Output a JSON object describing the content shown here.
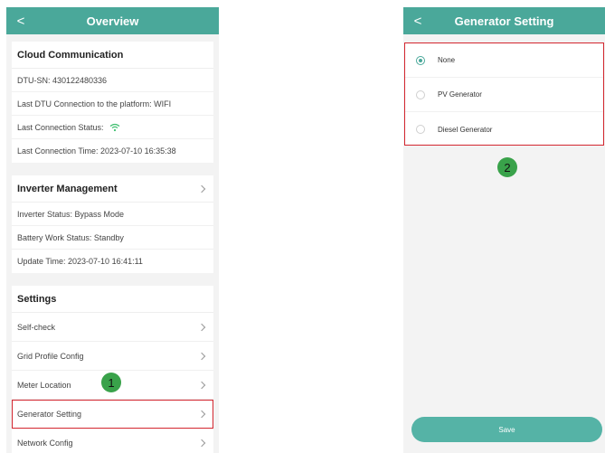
{
  "left": {
    "header": {
      "back_glyph": "<",
      "title": "Overview"
    },
    "cloud": {
      "title": "Cloud Communication",
      "dtu_sn": "DTU-SN: 430122480336",
      "last_dtu_conn": "Last DTU Connection to the platform: WIFI",
      "last_conn_status": "Last Connection Status:",
      "status_icon": "wifi-icon",
      "last_conn_time": "Last Connection Time: 2023-07-10 16:35:38"
    },
    "inverter": {
      "title": "Inverter Management",
      "inverter_status": "Inverter Status: Bypass Mode",
      "battery_status": "Battery Work Status: Standby",
      "update_time": "Update Time: 2023-07-10 16:41:11"
    },
    "settings": {
      "title": "Settings",
      "items": [
        {
          "label": "Self-check"
        },
        {
          "label": "Grid Profile Config"
        },
        {
          "label": "Meter Location"
        },
        {
          "label": "Generator Setting"
        },
        {
          "label": "Network Config"
        }
      ]
    },
    "step_badge": "1"
  },
  "right": {
    "header": {
      "back_glyph": "<",
      "title": "Generator Setting"
    },
    "options": [
      {
        "label": "None",
        "selected": true
      },
      {
        "label": "PV Generator",
        "selected": false
      },
      {
        "label": "Diesel Generator",
        "selected": false
      }
    ],
    "step_badge": "2",
    "save_label": "Save"
  },
  "colors": {
    "accent": "#4aa89a",
    "highlight": "#d3262f",
    "badge": "#39a24a"
  }
}
